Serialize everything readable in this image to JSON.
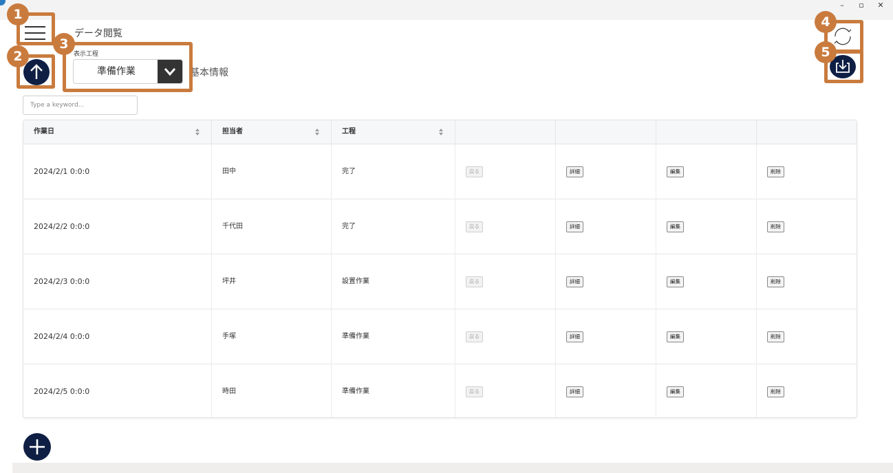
{
  "window": {
    "min_label": "–",
    "max_label": "▫",
    "close_label": "✕"
  },
  "header": {
    "title": "データ閲覧",
    "process_label": "表示工程",
    "process_value": "準備作業",
    "section_title": "基本情報"
  },
  "search": {
    "placeholder": "Type a keyword..."
  },
  "table": {
    "headers": [
      "作業日",
      "担当者",
      "工程"
    ],
    "rows": [
      {
        "date": "2024/2/1 0:0:0",
        "person": "田中",
        "process": "完了",
        "back": "戻る",
        "detail": "詳細",
        "edit": "編集",
        "delete": "削除"
      },
      {
        "date": "2024/2/2 0:0:0",
        "person": "千代田",
        "process": "完了",
        "back": "戻る",
        "detail": "詳細",
        "edit": "編集",
        "delete": "削除"
      },
      {
        "date": "2024/2/3 0:0:0",
        "person": "坪井",
        "process": "設置作業",
        "back": "戻る",
        "detail": "詳細",
        "edit": "編集",
        "delete": "削除"
      },
      {
        "date": "2024/2/4 0:0:0",
        "person": "手塚",
        "process": "準備作業",
        "back": "戻る",
        "detail": "詳細",
        "edit": "編集",
        "delete": "削除"
      },
      {
        "date": "2024/2/5 0:0:0",
        "person": "時田",
        "process": "準備作業",
        "back": "戻る",
        "detail": "詳細",
        "edit": "編集",
        "delete": "削除"
      }
    ]
  },
  "annotations": [
    "1",
    "2",
    "3",
    "4",
    "5"
  ],
  "colors": {
    "accent": "#c97b3e",
    "navy": "#0f1f44"
  },
  "icons": [
    "hamburger-menu-icon",
    "arrow-up-icon",
    "chevron-down-icon",
    "sync-icon",
    "download-icon",
    "plus-icon"
  ]
}
